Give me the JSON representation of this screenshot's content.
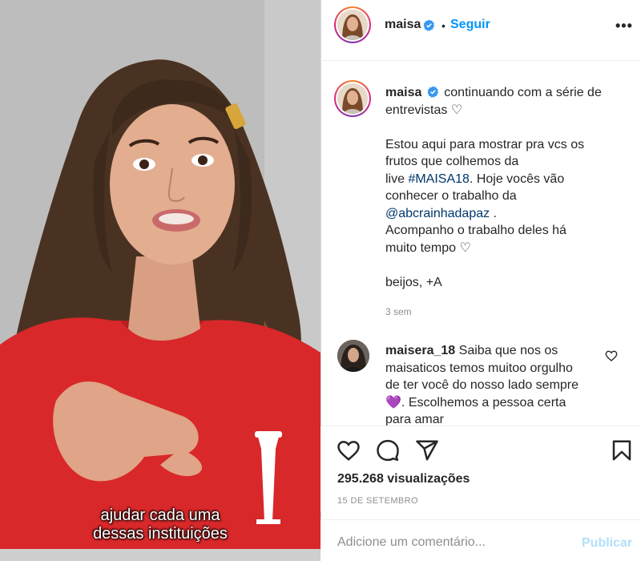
{
  "post": {
    "author": "maisa",
    "follow_label": "Seguir",
    "separator": "•",
    "more_label": "•••",
    "caption_lines": [
      "continuando com a série de",
      "entrevistas ♡",
      "Estou aqui para mostrar pra vcs os",
      "frutos que colhemos da",
      "live ",
      "#MAISA18",
      ". Hoje vocês vão",
      "conhecer o trabalho da",
      "@abcrainhadapaz",
      " .",
      "Acompanho o trabalho deles há",
      "muito tempo ♡",
      "beijos, +A"
    ],
    "caption_age": "3 sem"
  },
  "comment": {
    "author": "maisera_18",
    "text_lines": [
      "Saiba que nos os",
      "maisaticos temos muitoo orgulho",
      "de ter você do nosso lado sempre",
      "💜",
      ". Escolhemos a pessoa certa",
      "para amar"
    ]
  },
  "video": {
    "subtitle_line1": "ajudar cada uma",
    "subtitle_line2": "dessas instituições"
  },
  "stats": {
    "views": "295.268 visualizações",
    "date": "15 DE SETEMBRO"
  },
  "composer": {
    "placeholder": "Adicione um comentário...",
    "publish_label": "Publicar"
  },
  "colors": {
    "accent": "#0095f6",
    "link": "#00376b",
    "muted": "#8e8e8e",
    "publish_disabled": "#b2dffc",
    "shirt": "#d8282a"
  },
  "icons": [
    "verified-badge-icon",
    "more-options-icon",
    "heart-icon",
    "comment-icon",
    "share-icon",
    "save-icon",
    "comment-like-icon"
  ]
}
